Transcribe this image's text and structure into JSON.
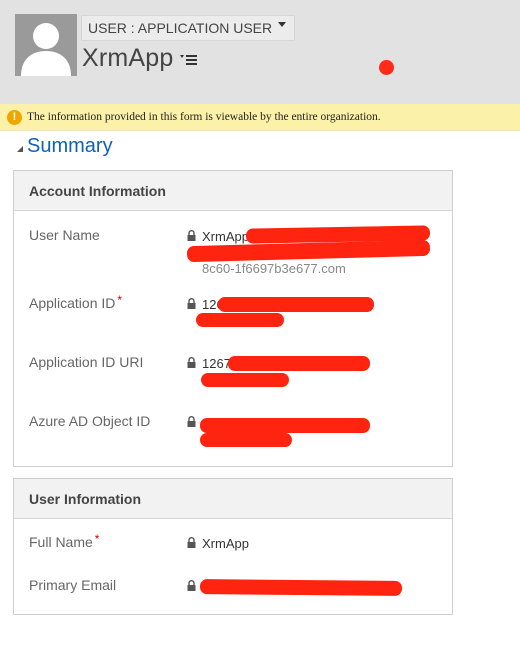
{
  "header": {
    "entity_type": "USER : APPLICATION USER",
    "record_name": "XrmApp"
  },
  "icons": {
    "avatar": "person-silhouette-icon",
    "dropdown": "caret-down-icon",
    "menu": "list-menu-icon",
    "warning": "warning-icon",
    "lock": "lock-icon",
    "collapse": "triangle-collapse-icon"
  },
  "notification": {
    "icon_text": "!",
    "text": "The information provided in this form is viewable by the entire organization."
  },
  "summary": {
    "title": "Summary"
  },
  "account_section": {
    "title": "Account Information",
    "fields": [
      {
        "label": "User Name",
        "value": "XrmApp",
        "value_line2": "8c60-1f6697b3e677.com",
        "required": ""
      },
      {
        "label": "Application ID",
        "value": "1267",
        "required": "*"
      },
      {
        "label": "Application ID URI",
        "value": "1267",
        "required": ""
      },
      {
        "label": "Azure AD Object ID",
        "value": "",
        "required": ""
      }
    ]
  },
  "user_section": {
    "title": "User Information",
    "fields": [
      {
        "label": "Full Name",
        "value": "XrmApp",
        "required": "*"
      },
      {
        "label": "Primary Email",
        "value": "",
        "required": ""
      }
    ]
  },
  "colors": {
    "header_bg": "#e2e2e2",
    "notice_bg": "#fcf1a8",
    "link_blue": "#1160b7",
    "redaction_red": "#ff2410",
    "required_red": "#cc0000"
  }
}
